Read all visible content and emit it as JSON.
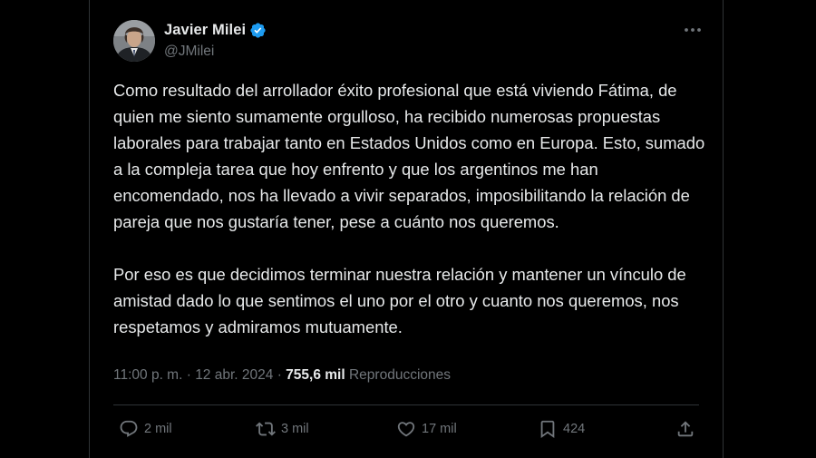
{
  "author": {
    "display_name": "Javier Milei",
    "handle": "@JMilei",
    "verified": true,
    "verified_color": "#1d9bf0"
  },
  "tweet": {
    "paragraphs": [
      "Como resultado del arrollador éxito profesional que está viviendo Fátima, de quien me siento sumamente orgulloso, ha recibido numerosas propuestas laborales para trabajar tanto en Estados Unidos como en Europa. Esto, sumado a la compleja tarea que hoy enfrento y que los argentinos me han encomendado, nos ha llevado a vivir separados, imposibilitando la relación de pareja que nos gustaría tener, pese a cuánto nos queremos.",
      "Por eso es que decidimos terminar nuestra relación y mantener un vínculo de amistad dado lo que sentimos el uno por el otro y cuanto nos queremos, nos respetamos y admiramos mutuamente."
    ]
  },
  "meta": {
    "time": "11:00 p. m.",
    "separator": " · ",
    "date": "12 abr. 2024",
    "views_count": "755,6 mil",
    "views_label": "Reproducciones"
  },
  "actions": {
    "replies": "2 mil",
    "reposts": "3 mil",
    "likes": "17 mil",
    "bookmarks": "424"
  },
  "icons": {
    "more": "more-horizontal-icon",
    "reply": "reply-icon",
    "repost": "repost-icon",
    "like": "heart-icon",
    "bookmark": "bookmark-icon",
    "share": "share-icon",
    "verified": "verified-badge-icon"
  },
  "colors": {
    "background": "#000000",
    "text_primary": "#e7e9ea",
    "text_secondary": "#71767b",
    "border": "#2f3336"
  }
}
